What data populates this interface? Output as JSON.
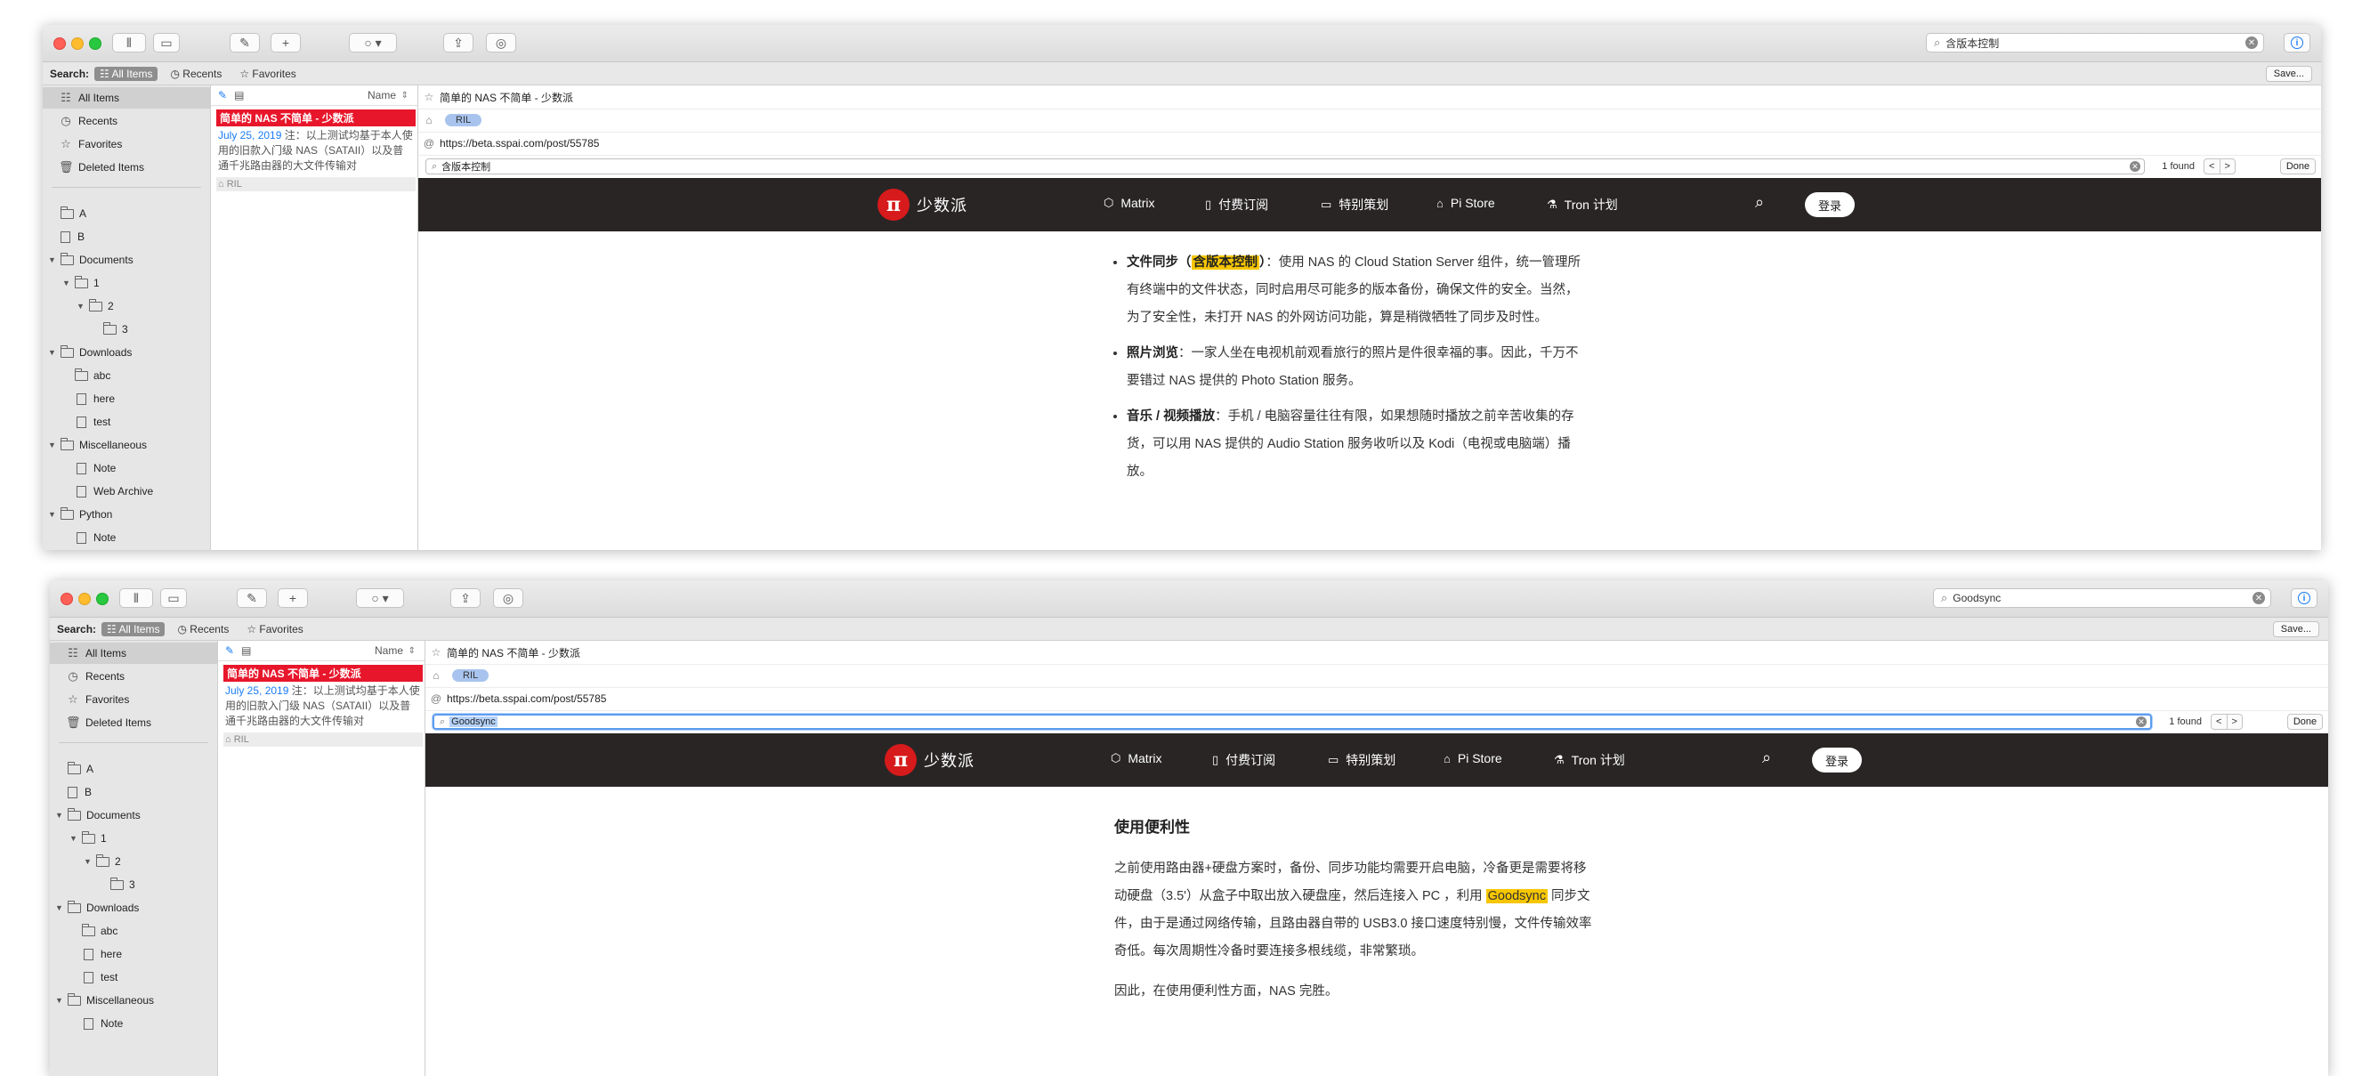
{
  "shared": {
    "scope_label": "Search:",
    "scopes": [
      "All Items",
      "Recents",
      "Favorites"
    ],
    "save_label": "Save...",
    "sidebar": {
      "top": [
        "All Items",
        "Recents",
        "Favorites",
        "Deleted Items"
      ],
      "folders": [
        "A",
        "B",
        "Documents",
        "1",
        "2",
        "3",
        "Downloads",
        "abc",
        "here",
        "test",
        "Miscellaneous",
        "Note",
        "Web Archive",
        "Python",
        "Note"
      ]
    },
    "list": {
      "sort_label": "Name",
      "entry_title": "简单的 NAS 不简单 - 少数派",
      "entry_date": "July 25, 2019",
      "entry_snippet": "注：以上测试均基于本人使用的旧款入门级 NAS（SATAII）以及普通千兆路由器的大文件传输对",
      "entry_tag": "RIL"
    },
    "detail": {
      "title": "简单的 NAS 不简单 - 少数派",
      "tag": "RIL",
      "url": "https://beta.sspai.com/post/55785",
      "found_text": "1 found",
      "done_label": "Done",
      "prev": "<",
      "next": ">"
    },
    "site": {
      "logo_glyph": "π",
      "logo_name": "少数派",
      "nav": [
        "Matrix",
        "付费订阅",
        "特别策划",
        "Pi Store",
        "Tron 计划"
      ],
      "login": "登录"
    }
  },
  "window1": {
    "search_value": "含版本控制",
    "find_value": "含版本控制",
    "bullets": [
      {
        "label": "文件同步（",
        "highlight": "含版本控制",
        "label_end": "）",
        "text": "：使用 NAS 的 Cloud Station Server 组件，统一管理所有终端中的文件状态，同时启用尽可能多的版本备份，确保文件的安全。当然，为了安全性，未打开 NAS 的外网访问功能，算是稍微牺牲了同步及时性。"
      },
      {
        "label": "照片浏览",
        "text": "：一家人坐在电视机前观看旅行的照片是件很幸福的事。因此，千万不要错过 NAS 提供的 Photo Station 服务。"
      },
      {
        "label": "音乐 / 视频播放",
        "text": "：手机 / 电脑容量往往有限，如果想随时播放之前辛苦收集的存货，可以用 NAS 提供的 Audio Station 服务收听以及 Kodi（电视或电脑端）播放。"
      }
    ]
  },
  "window2": {
    "search_value": "Goodsync",
    "find_value": "Goodsync",
    "heading": "使用便利性",
    "para1_before": "之前使用路由器+硬盘方案时，备份、同步功能均需要开启电脑，冷备更是需要将移动硬盘（3.5'）从盒子中取出放入硬盘座，然后连接入 PC ，利用 ",
    "para1_highlight": "Goodsync",
    "para1_after": " 同步文件，由于是通过网络传输，且路由器自带的 USB3.0 接口速度特别慢，文件传输效率奇低。每次周期性冷备时要连接多根线缆，非常繁琐。",
    "para2": "因此，在使用便利性方面，NAS 完胜。"
  }
}
